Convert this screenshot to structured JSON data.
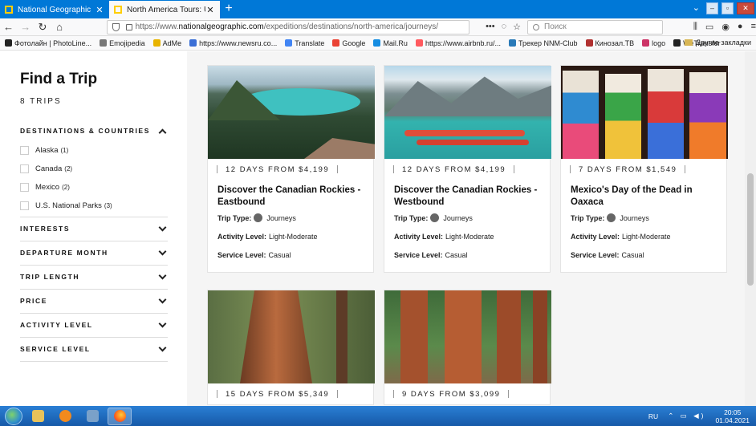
{
  "browser": {
    "tabs": [
      {
        "title": "National Geographic",
        "active": false
      },
      {
        "title": "North America Tours: USA, Can",
        "active": true
      }
    ],
    "new_tab": "+",
    "url_prefix": "https://www.",
    "url_host": "nationalgeographic.com",
    "url_path": "/expeditions/destinations/north-america/journeys/",
    "search_placeholder": "Поиск",
    "bookmarks": [
      {
        "label": "Фотолайн | PhotoLine...",
        "color": "#222222"
      },
      {
        "label": "Emojipedia",
        "color": "#777777"
      },
      {
        "label": "AdMe",
        "color": "#e8b400"
      },
      {
        "label": "https://www.newsru.co...",
        "color": "#3b6fd6"
      },
      {
        "label": "Translate",
        "color": "#4285f4"
      },
      {
        "label": "Google",
        "color": "#ea4335"
      },
      {
        "label": "Mail.Ru",
        "color": "#168de2"
      },
      {
        "label": "https://www.airbnb.ru/...",
        "color": "#ff5a5f"
      },
      {
        "label": "Трекер NNM-Club",
        "color": "#2a7ab8"
      },
      {
        "label": "Кинозал.ТВ",
        "color": "#b03030"
      },
      {
        "label": "logo",
        "color": "#cc3366"
      },
      {
        "label": "WeTransfer",
        "color": "#222222"
      }
    ],
    "other_bookmarks": "Другие закладки"
  },
  "sidebar": {
    "title": "Find a Trip",
    "trip_count": "8 TRIPS",
    "destinations": {
      "heading": "DESTINATIONS & COUNTRIES",
      "options": [
        {
          "label": "Alaska",
          "count": "(1)"
        },
        {
          "label": "Canada",
          "count": "(2)"
        },
        {
          "label": "Mexico",
          "count": "(2)"
        },
        {
          "label": "U.S. National Parks",
          "count": "(3)"
        }
      ]
    },
    "filters": [
      {
        "heading": "INTERESTS"
      },
      {
        "heading": "DEPARTURE MONTH"
      },
      {
        "heading": "TRIP LENGTH"
      },
      {
        "heading": "PRICE"
      },
      {
        "heading": "ACTIVITY LEVEL"
      },
      {
        "heading": "SERVICE LEVEL"
      }
    ]
  },
  "trips": [
    {
      "meta": "12 DAYS FROM $4,199",
      "name": "Discover the Canadian Rockies - Eastbound",
      "trip_type_label": "Trip Type:",
      "trip_type": "Journeys",
      "activity_label": "Activity Level:",
      "activity": "Light-Moderate",
      "service_label": "Service Level:",
      "service": "Casual",
      "image": "canadian-rockies-lake-valley"
    },
    {
      "meta": "12 DAYS FROM $4,199",
      "name": "Discover the Canadian Rockies - Westbound",
      "trip_type_label": "Trip Type:",
      "trip_type": "Journeys",
      "activity_label": "Activity Level:",
      "activity": "Light-Moderate",
      "service_label": "Service Level:",
      "service": "Casual",
      "image": "lake-louise-canoes"
    },
    {
      "meta": "7 DAYS FROM $1,549",
      "name": "Mexico's Day of the Dead in Oaxaca",
      "trip_type_label": "Trip Type:",
      "trip_type": "Journeys",
      "activity_label": "Activity Level:",
      "activity": "Light-Moderate",
      "service_label": "Service Level:",
      "service": "Casual",
      "image": "day-of-the-dead-skeletons"
    },
    {
      "meta": "15 DAYS FROM $5,349",
      "image": "giant-sequoia-trunk"
    },
    {
      "meta": "9 DAYS FROM $3,099",
      "image": "sequoia-grove"
    }
  ],
  "taskbar": {
    "lang": "RU",
    "time": "20:05",
    "date": "01.04.2021"
  },
  "colors": {
    "taskbar": "#1f6fc4",
    "tabstrip": "#0078d7",
    "main_bg": "#f5f5f5"
  }
}
